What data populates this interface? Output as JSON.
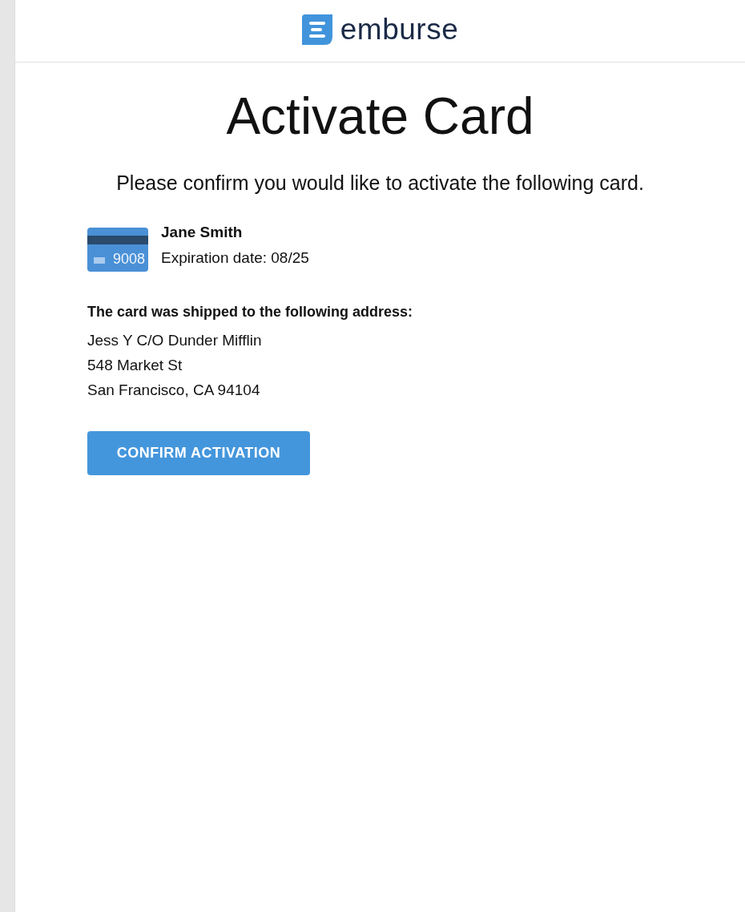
{
  "header": {
    "brand": "emburse"
  },
  "title": "Activate Card",
  "intro": "Please confirm you would like to activate the following card.",
  "card": {
    "last_digits": "9008",
    "holder": "Jane Smith",
    "expiration": "Expiration date: 08/25"
  },
  "shipping": {
    "heading": "The card was shipped to the following address:",
    "address_lines": [
      "Jess Y C/O Dunder Mifflin",
      "548 Market St",
      "San Francisco, CA 94104"
    ]
  },
  "button": "CONFIRM ACTIVATION"
}
